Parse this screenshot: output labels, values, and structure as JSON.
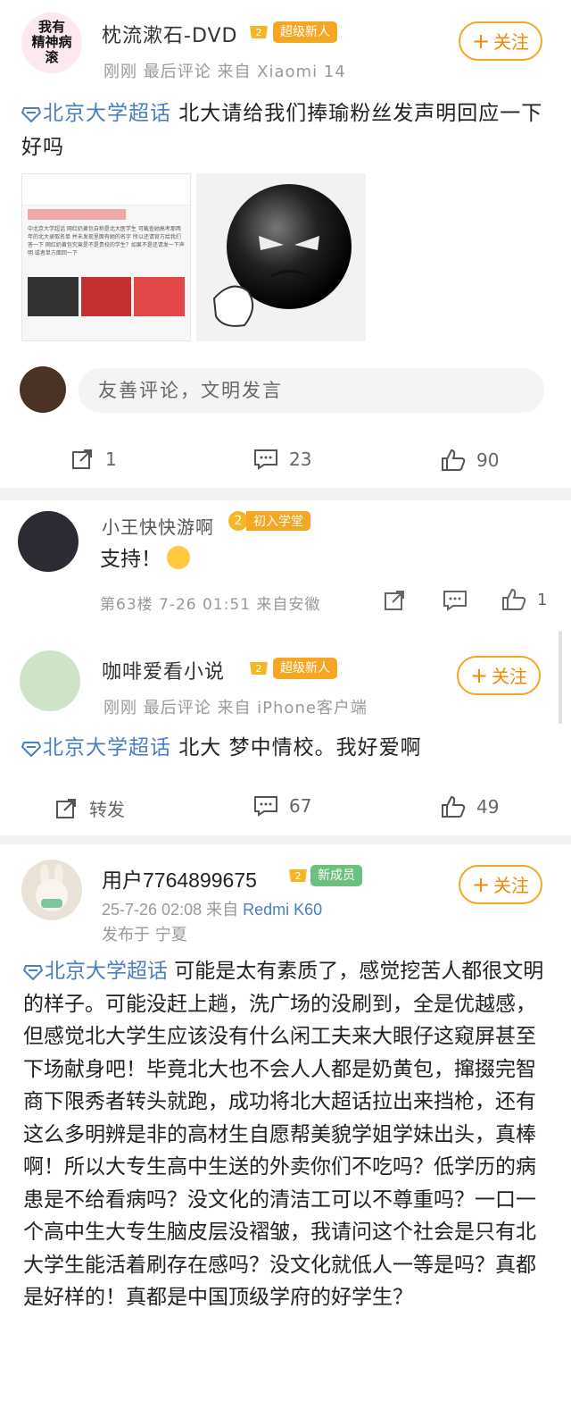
{
  "post1": {
    "avatar_text": "我有\n精神病\n滚",
    "username": "枕流漱石-DVD",
    "badge": "超级新人",
    "meta": "刚刚 最后评论  来自 Xiaomi 14",
    "follow": "关注",
    "topic": "北京大学超话",
    "text": " 北大请给我们捧瑜粉丝发声明回应一下好吗",
    "thumb_text": "中北京大学超话 网红奶黄包自称是北大医学生 可截查她高考那两年的北大录取名单 并未发现里面有她的名字 所以还请官方给我们答一下 网红奶黄包究竟是不是贵校的学生？如果不是还请发一下声明 或者单方面回一下",
    "comment_placeholder": "友善评论，文明发言",
    "repost_count": "1",
    "comment_count": "23",
    "like_count": "90"
  },
  "comment": {
    "username": "小王快快游啊",
    "level": "2",
    "badge": "初入学堂",
    "text": "支持！",
    "meta": "第63楼 7-26 01:51 来自安徽",
    "like_count": "1"
  },
  "post2": {
    "username": "咖啡爱看小说",
    "badge": "超级新人",
    "meta": "刚刚 最后评论  来自 iPhone客户端",
    "follow": "关注",
    "topic": "北京大学超话",
    "text": " 北大 梦中情校。我好爱啊",
    "repost_label": "转发",
    "comment_count": "67",
    "like_count": "49"
  },
  "post3": {
    "username": "用户7764899675",
    "badge": "新成员",
    "meta": "25-7-26 02:08  来自",
    "device": "Redmi K60",
    "location": "发布于 宁夏",
    "follow": "关注",
    "topic": "北京大学超话",
    "text": " 可能是太有素质了，感觉挖苦人都很文明的样子。可能没赶上趟，洗广场的没刷到，全是优越感，但感觉北大学生应该没有什么闲工夫来大眼仔这窥屏甚至下场献身吧！毕竟北大也不会人人都是奶黄包，撺掇完智商下限秀者转头就跑，成功将北大超话拉出来挡枪，还有这么多明辨是非的高材生自愿帮美貌学姐学妹出头，真棒啊！所以大专生高中生送的外卖你们不吃吗？低学历的病患是不给看病吗？没文化的清洁工可以不尊重吗？一口一个高中生大专生脑皮层没褶皱，我请问这个社会是只有北大学生能活着刷存在感吗？没文化就低人一等是吗？真都是好样的！真都是中国顶级学府的好学生？"
  },
  "colors": {
    "accent": "#f5a623",
    "topic": "#4a7fc1",
    "follow_text": "#f08a00"
  }
}
